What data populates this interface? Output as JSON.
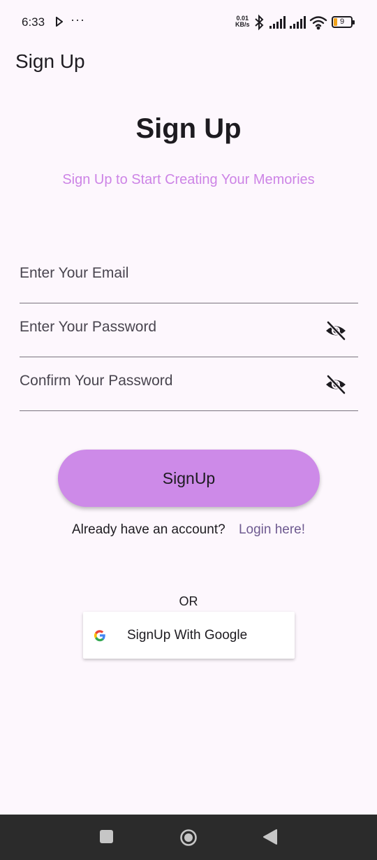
{
  "status_bar": {
    "time": "6:33",
    "more": "···",
    "net_speed_value": "0.01",
    "net_speed_unit": "KB/s",
    "battery": "9"
  },
  "app_bar": {
    "title": "Sign Up"
  },
  "header": {
    "title": "Sign Up",
    "subtitle": "Sign Up to Start Creating Your Memories"
  },
  "form": {
    "email": {
      "placeholder": "Enter Your Email",
      "value": ""
    },
    "password": {
      "placeholder": "Enter Your Password",
      "value": "",
      "toggle_icon": "visibility-off-icon"
    },
    "confirm_password": {
      "placeholder": "Confirm Your Password",
      "value": "",
      "toggle_icon": "visibility-off-icon"
    },
    "submit_label": "SignUp"
  },
  "login": {
    "prompt": "Already have an account?",
    "link": "Login here!"
  },
  "divider_label": "OR",
  "google": {
    "label": "SignUp With Google",
    "icon": "google-icon"
  },
  "colors": {
    "background": "#fdf7fd",
    "accent": "#cd8ae8",
    "subtitle": "#cd84e6",
    "link": "#6e5a90",
    "nav_bar": "#2b2b2b"
  },
  "nav": {
    "recents": "square-icon",
    "home": "circle-icon",
    "back": "triangle-back-icon"
  }
}
